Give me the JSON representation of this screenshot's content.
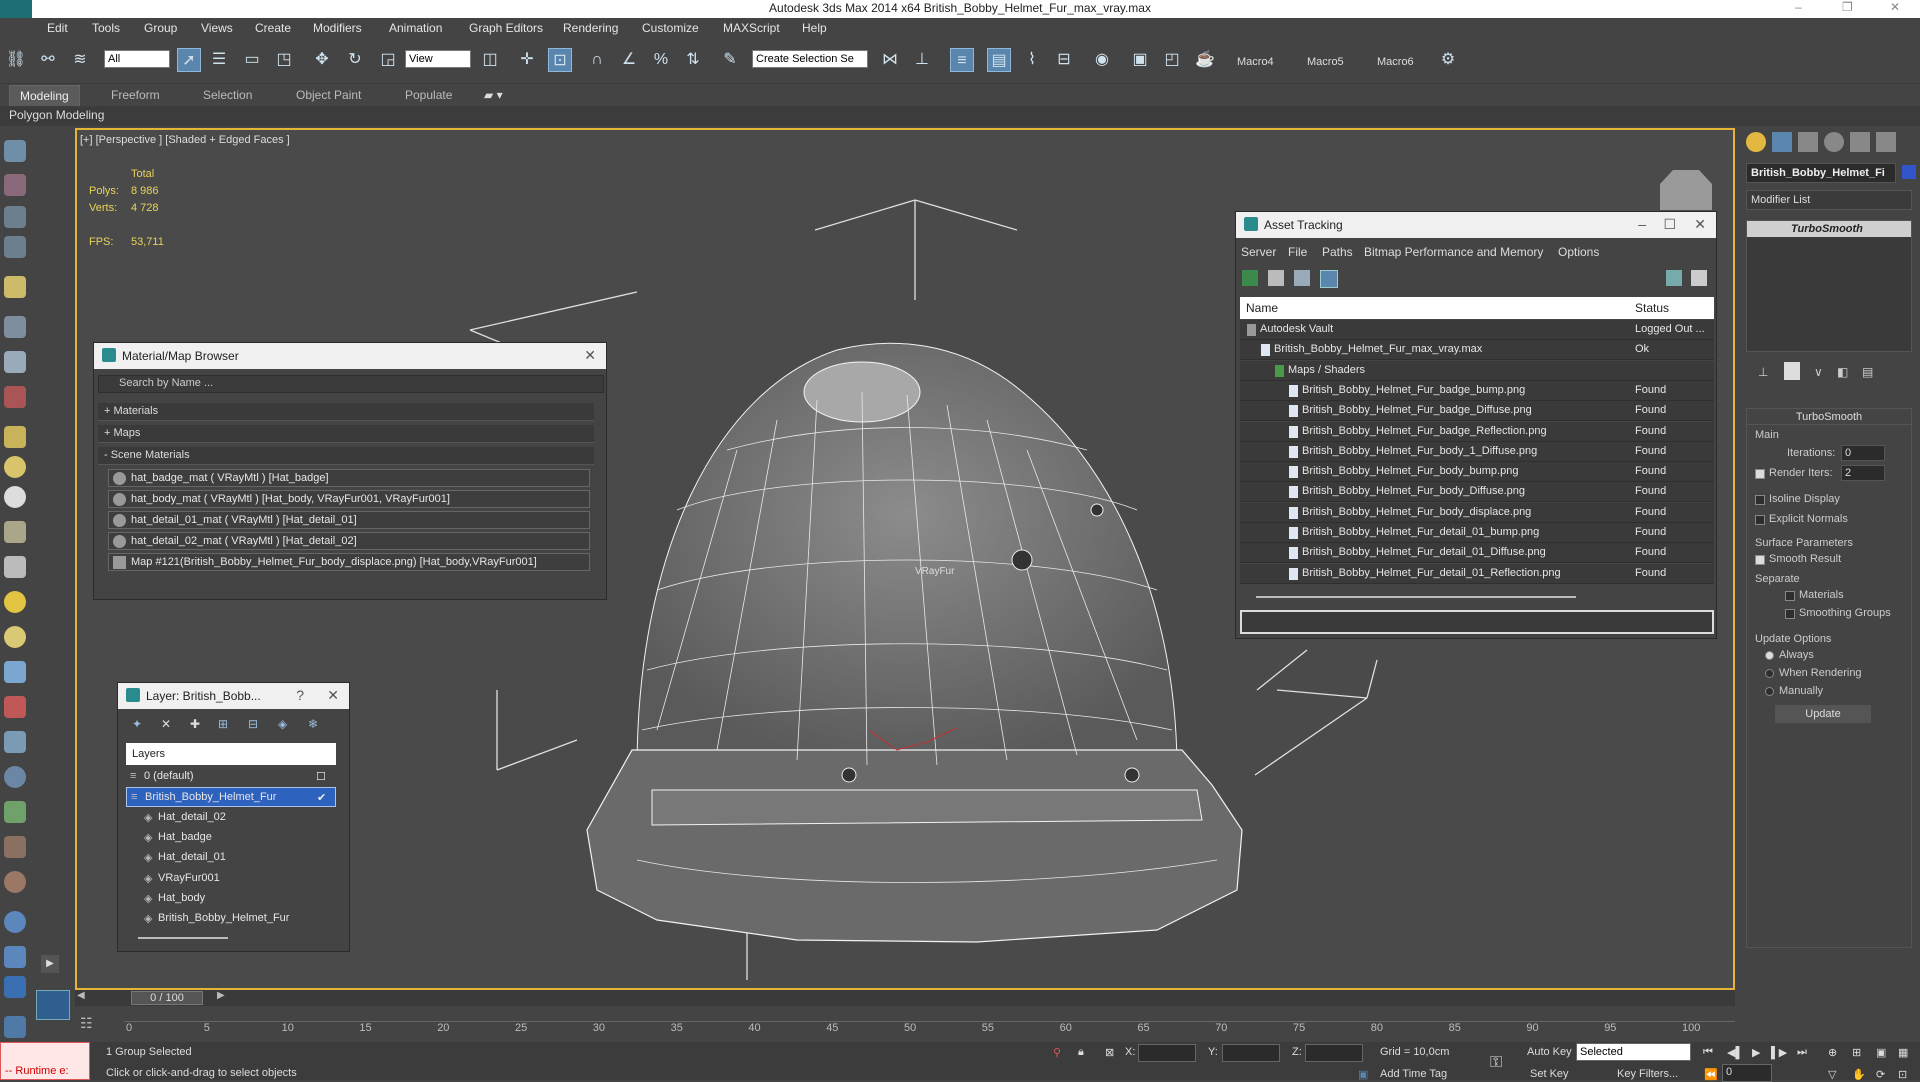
{
  "window": {
    "title": "Autodesk 3ds Max  2014 x64    British_Bobby_Helmet_Fur_max_vray.max",
    "controls": [
      "–",
      "❐",
      "✕"
    ]
  },
  "menubar": [
    "Edit",
    "Tools",
    "Group",
    "Views",
    "Create",
    "Modifiers",
    "Animation",
    "Graph Editors",
    "Rendering",
    "Customize",
    "MAXScript",
    "Help"
  ],
  "toolbar": {
    "filter_value": "All",
    "refcoord_value": "View",
    "selection_set_placeholder": "Create Selection Se",
    "macros": [
      "Macro4",
      "Macro5",
      "Macro6"
    ]
  },
  "ribbon": {
    "tabs": [
      "Modeling",
      "Freeform",
      "Selection",
      "Object Paint",
      "Populate"
    ],
    "active_tab": "Modeling",
    "panel": "Polygon Modeling"
  },
  "viewport": {
    "label": "[+] [Perspective ] [Shaded + Edged Faces ]",
    "stats": {
      "total_label": "Total",
      "polys_label": "Polys:",
      "polys_value": "8 986",
      "verts_label": "Verts:",
      "verts_value": "4 728",
      "fps_label": "FPS:",
      "fps_value": "53,711"
    },
    "object_label": "VRayFur"
  },
  "material_browser": {
    "title": "Material/Map Browser",
    "search_placeholder": "Search by Name ...",
    "sections": [
      "+ Materials",
      "+ Maps",
      "- Scene Materials"
    ],
    "items": [
      "hat_badge_mat  ( VRayMtl ) [Hat_badge]",
      "hat_body_mat  ( VRayMtl ) [Hat_body, VRayFur001, VRayFur001]",
      "hat_detail_01_mat  ( VRayMtl ) [Hat_detail_01]",
      "hat_detail_02_mat  ( VRayMtl ) [Hat_detail_02]",
      "Map #121(British_Bobby_Helmet_Fur_body_displace.png) [Hat_body,VRayFur001]"
    ]
  },
  "asset_tracking": {
    "title": "Asset Tracking",
    "menu": [
      "Server",
      "File",
      "Paths",
      "Bitmap Performance and Memory",
      "Options"
    ],
    "columns": [
      "Name",
      "Status"
    ],
    "rows": [
      {
        "name": "Autodesk Vault",
        "status": "Logged Out ..."
      },
      {
        "name": "British_Bobby_Helmet_Fur_max_vray.max",
        "status": "Ok"
      },
      {
        "name": "Maps / Shaders",
        "status": ""
      },
      {
        "name": "British_Bobby_Helmet_Fur_badge_bump.png",
        "status": "Found"
      },
      {
        "name": "British_Bobby_Helmet_Fur_badge_Diffuse.png",
        "status": "Found"
      },
      {
        "name": "British_Bobby_Helmet_Fur_badge_Reflection.png",
        "status": "Found"
      },
      {
        "name": "British_Bobby_Helmet_Fur_body_1_Diffuse.png",
        "status": "Found"
      },
      {
        "name": "British_Bobby_Helmet_Fur_body_bump.png",
        "status": "Found"
      },
      {
        "name": "British_Bobby_Helmet_Fur_body_Diffuse.png",
        "status": "Found"
      },
      {
        "name": "British_Bobby_Helmet_Fur_body_displace.png",
        "status": "Found"
      },
      {
        "name": "British_Bobby_Helmet_Fur_detail_01_bump.png",
        "status": "Found"
      },
      {
        "name": "British_Bobby_Helmet_Fur_detail_01_Diffuse.png",
        "status": "Found"
      },
      {
        "name": "British_Bobby_Helmet_Fur_detail_01_Reflection.png",
        "status": "Found"
      }
    ]
  },
  "layer_panel": {
    "title": "Layer: British_Bobb...",
    "help": "?",
    "header": "Layers",
    "items": [
      "0 (default)",
      "British_Bobby_Helmet_Fur",
      "Hat_detail_02",
      "Hat_badge",
      "Hat_detail_01",
      "VRayFur001",
      "Hat_body",
      "British_Bobby_Helmet_Fur"
    ]
  },
  "command_panel": {
    "object_name": "British_Bobby_Helmet_Fi",
    "modifier_list": "Modifier List",
    "stack_item": "TurboSmooth",
    "rollout_title": "TurboSmooth",
    "main_label": "Main",
    "iterations_label": "Iterations:",
    "iterations_value": "0",
    "render_iters_label": "Render Iters:",
    "render_iters_value": "2",
    "isoline": "Isoline Display",
    "explicit_normals": "Explicit Normals",
    "surface_params": "Surface Parameters",
    "smooth_result": "Smooth Result",
    "separate": "Separate",
    "materials": "Materials",
    "smoothing_groups": "Smoothing Groups",
    "update_options": "Update Options",
    "always": "Always",
    "when_rendering": "When Rendering",
    "manually": "Manually",
    "update_button": "Update"
  },
  "timeline": {
    "frame": "0 / 100",
    "ticks": [
      "0",
      "5",
      "10",
      "15",
      "20",
      "25",
      "30",
      "35",
      "40",
      "45",
      "50",
      "55",
      "60",
      "65",
      "70",
      "75",
      "80",
      "85",
      "90",
      "95",
      "100"
    ]
  },
  "statusbar": {
    "runtime": "-- Runtime e:",
    "selected": "1 Group Selected",
    "prompt": "Click or click-and-drag to select objects",
    "x_label": "X:",
    "y_label": "Y:",
    "z_label": "Z:",
    "grid": "Grid = 10,0cm",
    "add_time_tag": "Add Time Tag",
    "auto_key": "Auto Key",
    "set_key": "Set Key",
    "selected_value": "Selected",
    "key_filters": "Key Filters...",
    "frame_value": "0"
  },
  "colors": {
    "accent": "#5a86ad",
    "viewport_border": "#e6b43a",
    "selection": "#2e62bf"
  }
}
